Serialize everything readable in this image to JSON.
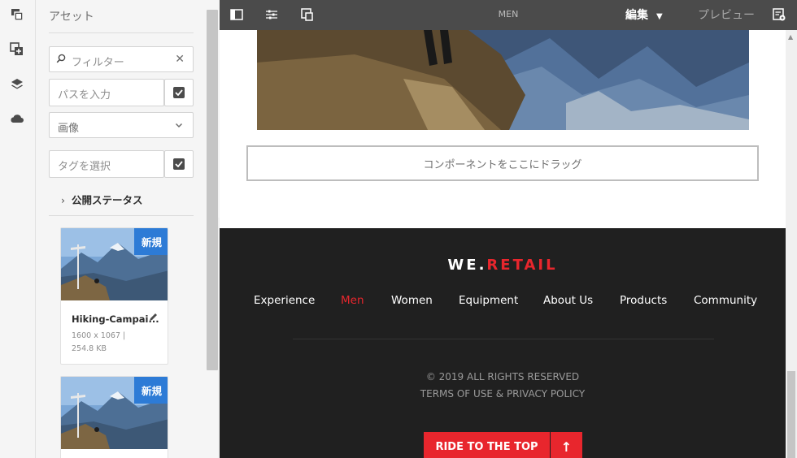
{
  "rail": {
    "items": [
      {
        "name": "asset-finder-icon"
      },
      {
        "name": "components-icon"
      },
      {
        "name": "layers-icon"
      },
      {
        "name": "cloud-icon"
      }
    ]
  },
  "assets_panel": {
    "title": "アセット",
    "filter_placeholder": "フィルター",
    "path_placeholder": "パスを入力",
    "type_select": "画像",
    "tag_placeholder": "タグを選択",
    "publish_status": "公開ステータス",
    "cards": [
      {
        "badge": "新規",
        "name": "Hiking-Campai...",
        "meta": "1600 x 1067 | 254.8 KB"
      },
      {
        "badge": "新規",
        "name": "",
        "meta": ""
      }
    ]
  },
  "topbar": {
    "page_title": "MEN",
    "mode": "編集",
    "preview": "プレビュー"
  },
  "canvas": {
    "dropzone": "コンポーネントをここにドラッグ",
    "footer": {
      "logo_main": "WE.",
      "logo_accent": "RETAIL",
      "nav": [
        "Experience",
        "Men",
        "Women",
        "Equipment",
        "About Us",
        "Products",
        "Community"
      ],
      "active_nav": "Men",
      "copyright": "© 2019 ALL RIGHTS RESERVED",
      "terms": "TERMS OF USE & PRIVACY POLICY",
      "ride": "RIDE TO THE TOP",
      "ride_arrow": "↑"
    }
  },
  "colors": {
    "topbar": "#4b4b4b",
    "brand_red": "#e8262d",
    "badge_blue": "#2d7bd6",
    "footer_bg": "#202020"
  }
}
